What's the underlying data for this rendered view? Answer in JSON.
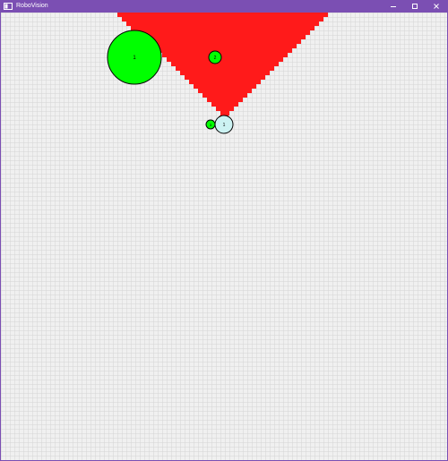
{
  "window": {
    "title": "RoboVision",
    "accent_color": "#7b4fb3"
  },
  "window_controls": [
    {
      "name": "minimize",
      "icon": "minimize-icon"
    },
    {
      "name": "maximize",
      "icon": "maximize-icon"
    },
    {
      "name": "close",
      "icon": "close-icon"
    }
  ],
  "scene": {
    "grid_cell_size": 5,
    "grid_color": "#d4d4d4",
    "background_color": "#f0f0f0",
    "vision_cone_color": "#ff1a1a",
    "object_color": "#00ff00",
    "robot_color": "#ccf2f2",
    "labels": {
      "large_object": "1",
      "small_object_1": "2",
      "small_object_2": "3",
      "robot": "1"
    }
  }
}
